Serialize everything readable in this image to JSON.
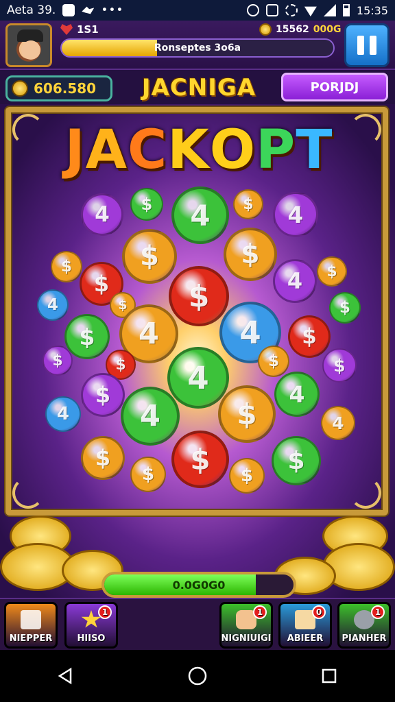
{
  "status_bar": {
    "left_text": "Aeta 39.",
    "time": "15:35"
  },
  "hud": {
    "level": "1S1",
    "xp_label": "Ronseptes 3o6a",
    "xp_progress": 0.35,
    "coins_label": "15562",
    "coins_gold": "000G"
  },
  "row2": {
    "balance": "606.580",
    "title": "JACNIGA",
    "button_label": "PORJDJ"
  },
  "stage": {
    "jackpot_letters": [
      "J",
      "A",
      "C",
      "K",
      "O",
      "P",
      "T"
    ],
    "progress_label": "0.0G0G0",
    "progress_value": 0.8
  },
  "toolbar": {
    "items": [
      {
        "label": "NIEPPER",
        "color": "#f08a1a",
        "badge": ""
      },
      {
        "label": "HIISO",
        "color": "#8a3ad6",
        "badge": "1"
      },
      {
        "label": "NIGNIUIGI",
        "color": "#3cbf2a",
        "badge": "1"
      },
      {
        "label": "ABIEER",
        "color": "#2a9ad8",
        "badge": "0"
      },
      {
        "label": "PIANHER",
        "color": "#3cbf2a",
        "badge": "1"
      }
    ]
  },
  "colors": {
    "gold": "#ffd33a",
    "green_coin": "#3cc23a",
    "red_coin": "#e02a1a",
    "purple_coin": "#a03ad8",
    "blue_coin": "#3a9ae8",
    "orange_coin": "#f0a020"
  },
  "icons": {
    "pause": "pause-icon",
    "back": "nav-back-icon",
    "home": "nav-home-icon",
    "recents": "nav-recents-icon"
  }
}
